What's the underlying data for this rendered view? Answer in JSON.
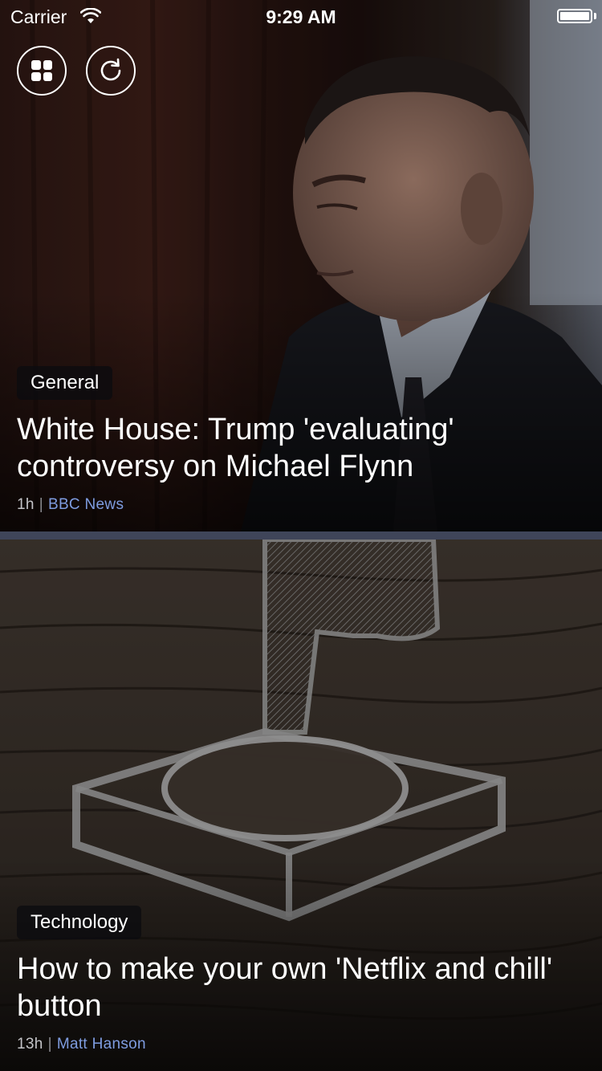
{
  "status_bar": {
    "carrier": "Carrier",
    "time": "9:29 AM"
  },
  "toolbar": {
    "grid_icon": "grid-icon",
    "refresh_icon": "refresh-icon"
  },
  "articles": [
    {
      "category": "General",
      "headline": "White House: Trump 'evaluating' controversy on Michael Flynn",
      "age": "1h",
      "source": "BBC News"
    },
    {
      "category": "Technology",
      "headline": "How to make your own 'Netflix and chill' button",
      "age": "13h",
      "source": "Matt Hanson"
    }
  ],
  "colors": {
    "divider": "#3f4559",
    "source_link": "#7e9ce0",
    "tag_bg": "#0c0c10"
  }
}
